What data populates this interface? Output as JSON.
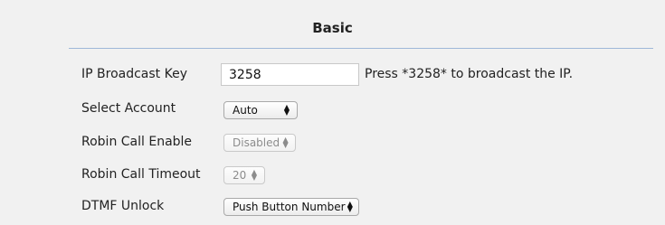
{
  "section": {
    "title": "Basic"
  },
  "fields": {
    "ip_broadcast_key": {
      "label": "IP Broadcast Key",
      "value": "3258",
      "hint": "Press *3258* to broadcast the IP."
    },
    "select_account": {
      "label": "Select Account",
      "value": "Auto",
      "enabled": true
    },
    "robin_call_enable": {
      "label": "Robin Call Enable",
      "value": "Disabled",
      "enabled": false
    },
    "robin_call_timeout": {
      "label": "Robin Call Timeout",
      "value": "20",
      "enabled": false
    },
    "dtmf_unlock": {
      "label": "DTMF Unlock",
      "value": "Push Button Number",
      "enabled": true
    }
  },
  "icons": {
    "select_arrows": "up-down-chevron-icon"
  },
  "colors": {
    "background": "#f1f1f1",
    "title_rule": "#9fb7d8"
  }
}
